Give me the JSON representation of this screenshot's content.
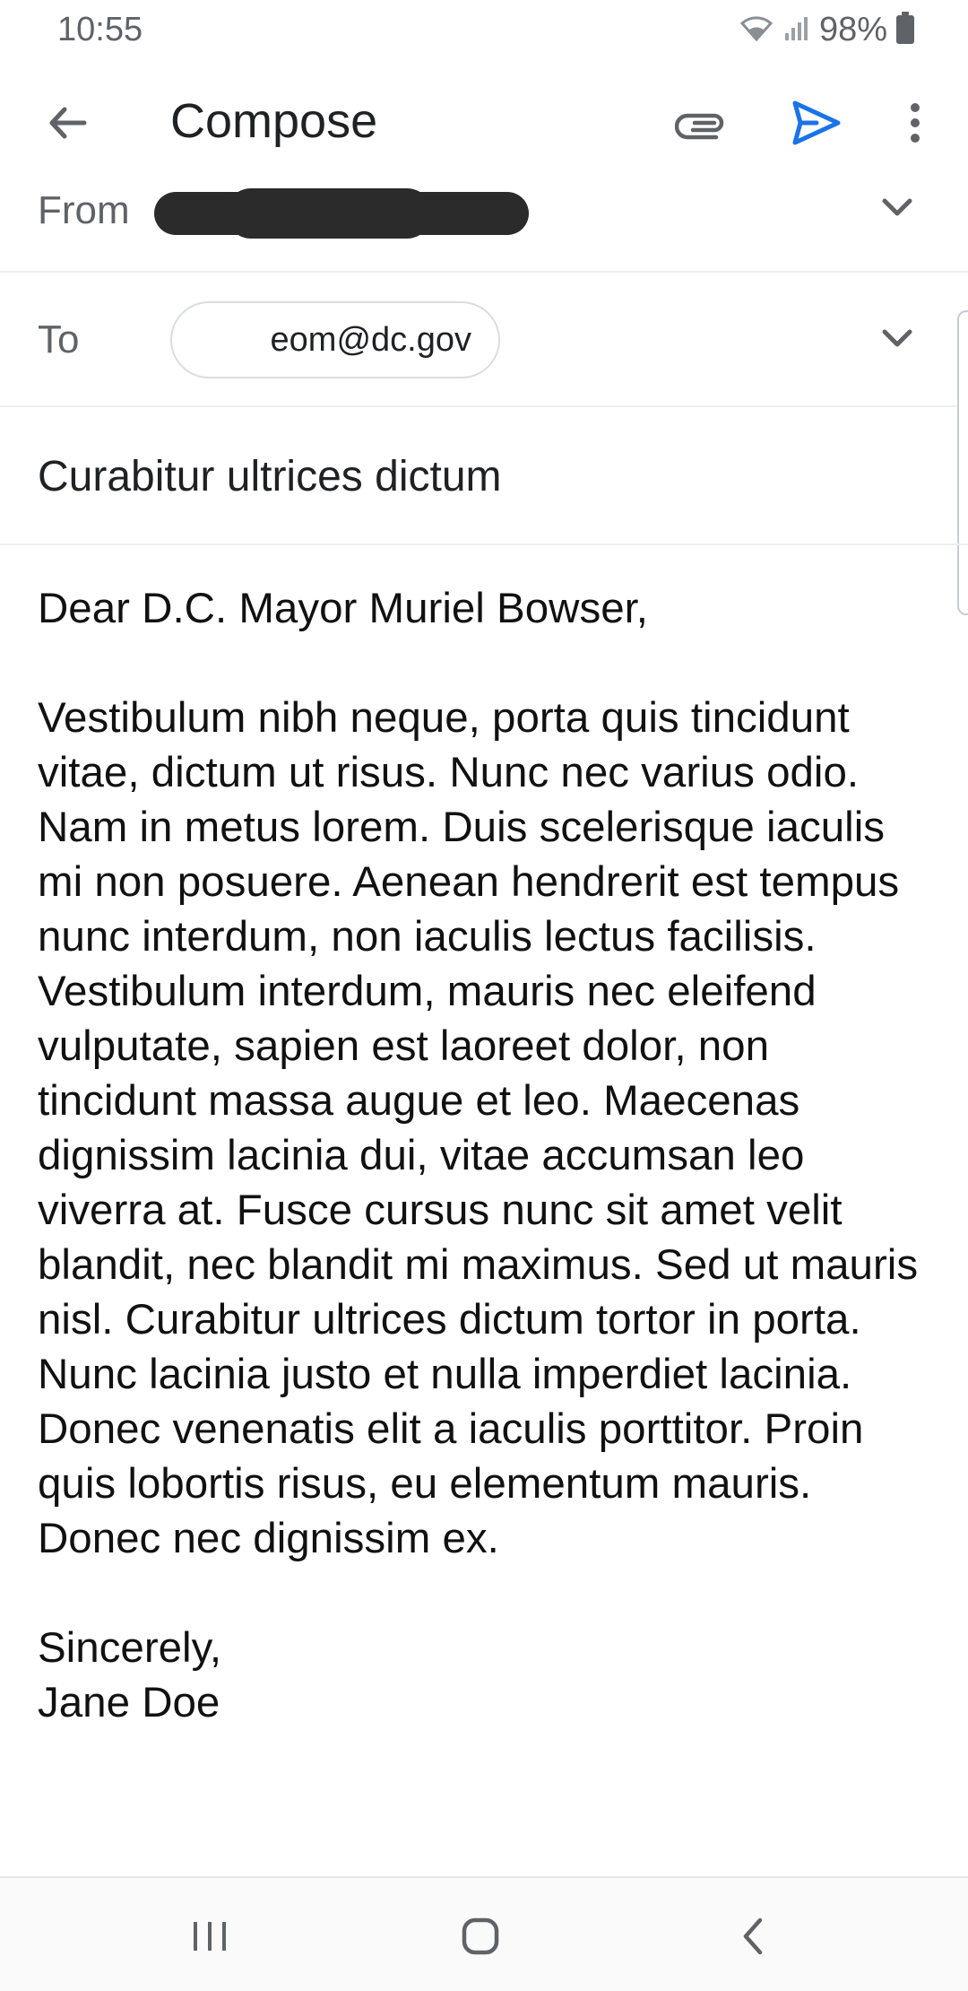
{
  "status_bar": {
    "time": "10:55",
    "battery": "98%"
  },
  "app_bar": {
    "title": "Compose",
    "icons": [
      "arrow-back-icon",
      "attach-icon",
      "send-icon",
      "more-vert-icon"
    ],
    "send_color": "#1a73e8"
  },
  "compose": {
    "from_label": "From",
    "to_label": "To",
    "to_recipient": "eom@dc.gov",
    "subject": "Curabitur ultrices dictum",
    "body": "Dear D.C. Mayor Muriel Bowser,\n\nVestibulum nibh neque, porta quis tincidunt vitae, dictum ut risus. Nunc nec varius odio. Nam in metus lorem. Duis scelerisque iaculis mi non posuere. Aenean hendrerit est tempus nunc interdum, non iaculis lectus facilisis. Vestibulum interdum, mauris nec eleifend vulputate, sapien est laoreet dolor, non tincidunt massa augue et leo. Maecenas dignissim lacinia dui, vitae accumsan leo viverra at. Fusce cursus nunc sit amet velit blandit, nec blandit mi maximus. Sed ut mauris nisl. Curabitur ultrices dictum tortor in porta. Nunc lacinia justo et nulla imperdiet lacinia. Donec venenatis elit a iaculis porttitor. Proin quis lobortis risus, eu elementum mauris. Donec nec dignissim ex.\n\nSincerely,\nJane Doe"
  }
}
